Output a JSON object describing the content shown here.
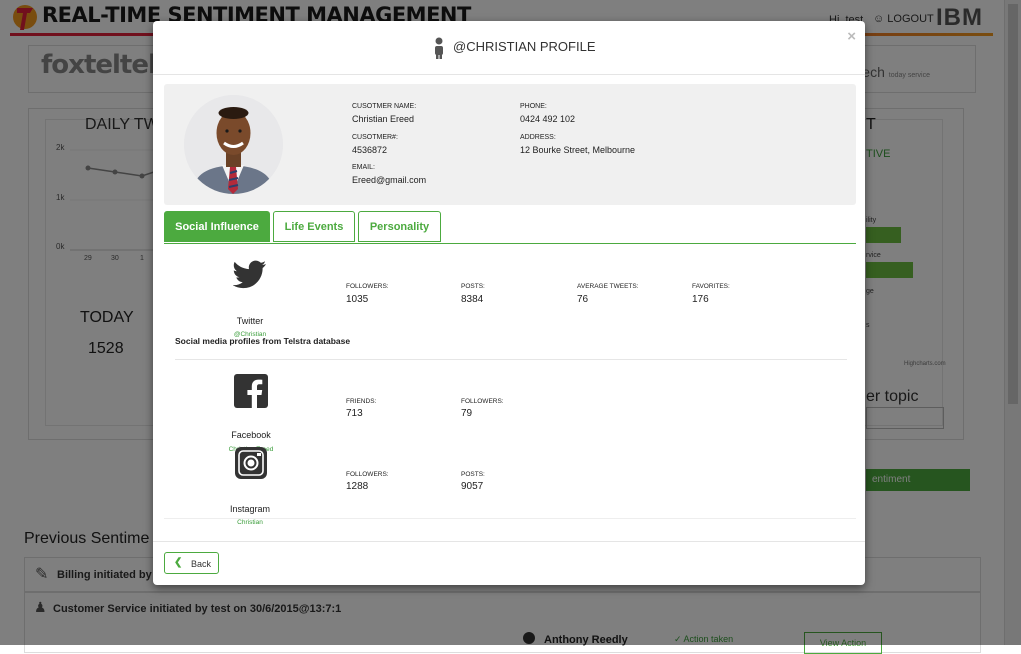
{
  "app": {
    "title": "REAL-TIME SENTIMENT MANAGEMENT",
    "greeting": "Hi, test",
    "logout_label": "LOGOUT",
    "ibm_label": "IBM",
    "brand": "foxteltels",
    "brand_suffix": "ech",
    "brand_suffix_sub": "today service"
  },
  "background": {
    "daily_title": "DAILY TW",
    "y_ticks": [
      "2k",
      "1k",
      "0k"
    ],
    "x_ticks": [
      "29",
      "30",
      "1"
    ],
    "today_label": "TODAY",
    "today_value": "1528",
    "right_title": "T",
    "right_subtitle": "TIVE",
    "right_labels": [
      "ility",
      "rvice",
      "ge",
      "s"
    ],
    "highcharts_credit": "Highcharts.com",
    "topic_label": "er topic",
    "sentiment_button": "entiment",
    "previous_title": "Previous Sentime",
    "list_items": [
      {
        "label": "Billing initiated by"
      },
      {
        "label": "Customer Service initiated by test on 30/6/2015@13:7:1"
      }
    ],
    "row_name": "Anthony Reedly",
    "action_taken": "✓ Action taken",
    "view_action": "View Action"
  },
  "modal": {
    "title": "@CHRISTIAN PROFILE",
    "close_label": "×",
    "customer": {
      "name_label": "CUSOTMER NAME:",
      "name": "Christian Ereed",
      "number_label": "CUSOTMER#:",
      "number": "4536872",
      "email_label": "EMAIL:",
      "email": "Ereed@gmail.com",
      "phone_label": "PHONE:",
      "phone": "0424 492 102",
      "address_label": "ADDRESS:",
      "address": "12 Bourke Street, Melbourne"
    },
    "tabs": [
      {
        "label": "Social Influence",
        "active": true
      },
      {
        "label": "Life Events",
        "active": false
      },
      {
        "label": "Personality",
        "active": false
      }
    ],
    "twitter": {
      "name": "Twitter",
      "handle": "@Christian",
      "stats": [
        {
          "label": "FOLLOWERS:",
          "value": "1035"
        },
        {
          "label": "POSTS:",
          "value": "8384"
        },
        {
          "label": "AVERAGE TWEETS:",
          "value": "76"
        },
        {
          "label": "FAVORITES:",
          "value": "176"
        }
      ]
    },
    "section_title": "Social media profiles from Telstra database",
    "facebook": {
      "name": "Facebook",
      "handle": "Christian Ereed",
      "stats": [
        {
          "label": "FRIENDS:",
          "value": "713"
        },
        {
          "label": "FOLLOWERS:",
          "value": "79"
        }
      ]
    },
    "instagram": {
      "name": "Instagram",
      "handle": "Christian",
      "stats": [
        {
          "label": "FOLLOWERS:",
          "value": "1288"
        },
        {
          "label": "POSTS:",
          "value": "9057"
        }
      ]
    },
    "back_label": "Back"
  },
  "colors": {
    "accent_green": "#4caa3f",
    "telstra_red": "#e2203a",
    "telstra_orange": "#f39a1f"
  }
}
